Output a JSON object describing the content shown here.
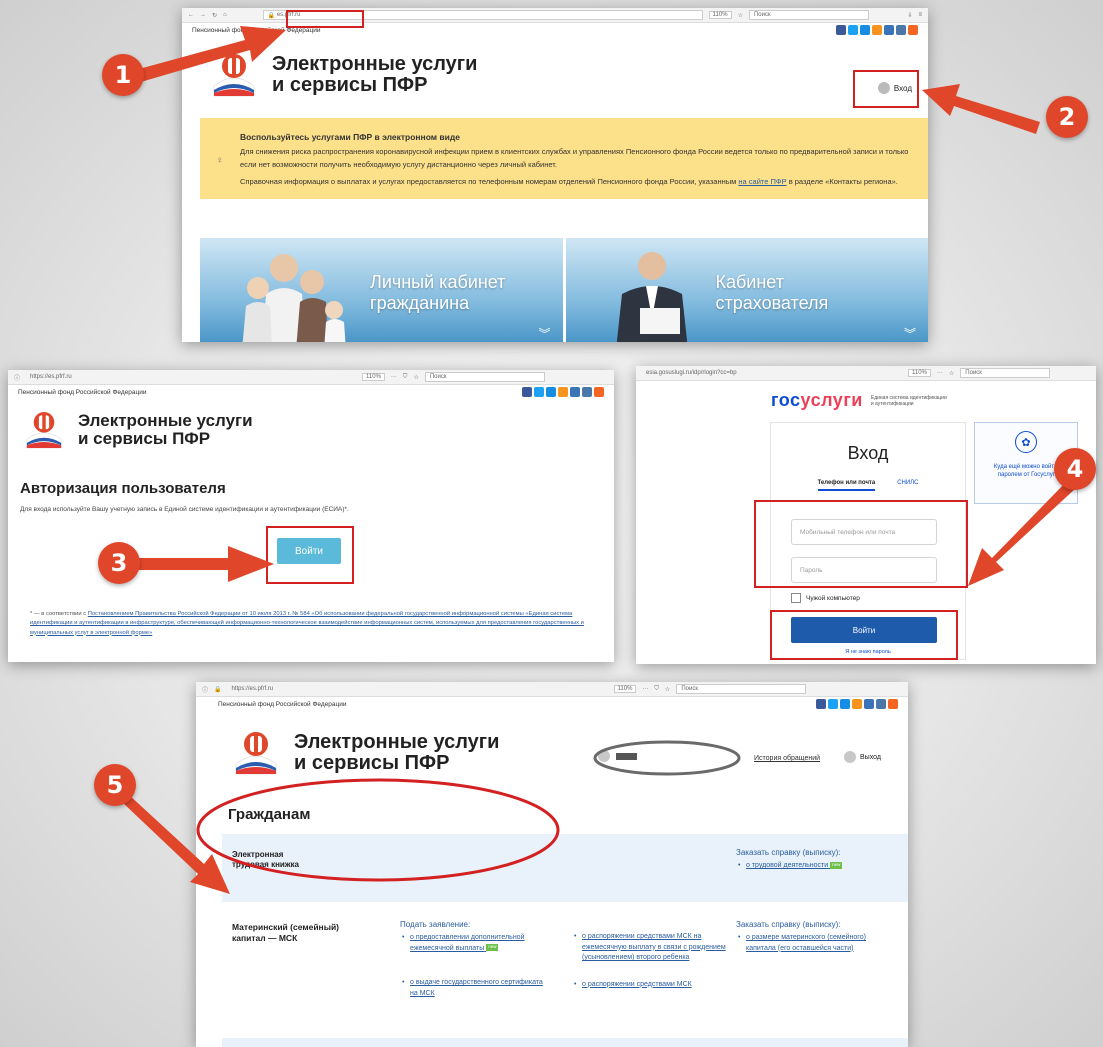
{
  "panel1": {
    "browser": {
      "url": "es.pfrf.ru",
      "zoom": "110%",
      "search_placeholder": "Поиск"
    },
    "org_name": "Пенсионный фонд Российской Федерации",
    "site_title_line1": "Электронные услуги",
    "site_title_line2": "и сервисы ПФР",
    "login_label": "Вход",
    "notice": {
      "heading": "Воспользуйтесь услугами ПФР в электронном виде",
      "para1": "Для снижения риска распространения коронавирусной инфекции прием в клиентских службах и управлениях Пенсионного фонда России ведется только по предварительной записи и только если нет возможности получить необходимую услугу дистанционно через личный кабинет.",
      "para2_start": "Справочная информация о выплатах и услугах предоставляется по телефонным номерам отделений Пенсионного фонда России, указанным",
      "para2_link": "на сайте ПФР",
      "para2_end": "в разделе «Контакты региона»."
    },
    "banner_left_line1": "Личный кабинет",
    "banner_left_line2": "гражданина",
    "banner_right_line1": "Кабинет",
    "banner_right_line2": "страхователя"
  },
  "panel2": {
    "browser": {
      "url": "https://es.pfrf.ru",
      "zoom": "110%",
      "search_placeholder": "Поиск"
    },
    "org_name": "Пенсионный фонд Российской Федерации",
    "site_title_line1": "Электронные услуги",
    "site_title_line2": "и сервисы ПФР",
    "heading": "Авторизация пользователя",
    "description": "Для входа используйте Вашу учетную запись в Единой системе идентификации и аутентификации (ЕСИА)*.",
    "login_button": "Войти",
    "footnote_start": "* — в соответствии с",
    "footnote_link": "Постановлением Правительства Российской Федерации от 10 июля 2013 г. № 584 «Об использовании федеральной государственной информационной системы «Единая система идентификации и аутентификации в инфраструктуре, обеспечивающей информационно-технологическое взаимодействие информационных систем, используемых для предоставления государственных и муниципальных услуг в электронной форме»"
  },
  "panel3": {
    "browser": {
      "url": "esia.gosuslugi.ru/idp/rlogin?cc=bp",
      "zoom": "110%",
      "search_placeholder": "Поиск"
    },
    "brand_gos": "гос",
    "brand_uslugi": "услуги",
    "brand_caption": "Единая система идентификации и аутентификации",
    "title": "Вход",
    "tab_phone": "Телефон или почта",
    "tab_snils": "СНИЛС",
    "phone_placeholder": "Мобильный телефон или почта",
    "password_placeholder": "Пароль",
    "foreign_computer": "Чужой компьютер",
    "login_button": "Войти",
    "forgot_link": "Я не знаю пароль",
    "side_hint": "Куда ещё можно войти с паролем от Госуслуг?"
  },
  "panel4": {
    "browser": {
      "url": "https://es.pfrf.ru",
      "zoom": "110%",
      "search_placeholder": "Поиск"
    },
    "org_name": "Пенсионный фонд Российской Федерации",
    "site_title_line1": "Электронные услуги",
    "site_title_line2": "и сервисы ПФР",
    "user_name": "Б...........Р.",
    "history_link": "История обращений",
    "logout_label": "Выход",
    "section_title": "Гражданам",
    "etk": {
      "title_line1": "Электронная",
      "title_line2": "трудовая книжка",
      "order_label": "Заказать справку (выписку):",
      "item": "о трудовой деятельности",
      "new_tag": "new"
    },
    "msk": {
      "title_line1": "Материнский (семейный)",
      "title_line2": "капитал — МСК",
      "apply_label": "Подать заявление:",
      "items_col1": [
        "о предоставлении дополнительной ежемесячной выплаты",
        "о выдаче государственного сертификата на МСК"
      ],
      "items_col2": [
        "о распоряжении средствами МСК на ежемесячную выплату в связи с рождением (усыновлением) второго ребенка",
        "о распоряжении средствами МСК"
      ],
      "order_label": "Заказать справку (выписку):",
      "order_item": "о размере материнского (семейного) капитала (его оставшейся части)",
      "new_tag": "new"
    }
  },
  "markers": [
    "1",
    "2",
    "3",
    "4",
    "5"
  ],
  "colors": {
    "accent_red": "#e0462a",
    "pfr_blue": "#2a5d9f",
    "gos_blue": "#0d4cd3",
    "gos_red": "#ee3f58",
    "login_blue": "#1f5bab",
    "notice_yellow": "#fde08a"
  }
}
